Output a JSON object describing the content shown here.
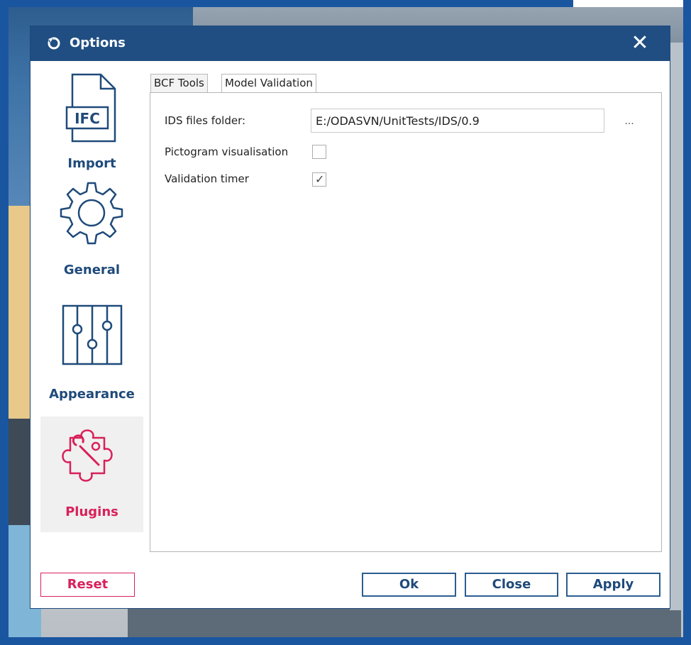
{
  "dialog": {
    "title": "Options",
    "title_icon": "refresh-circle-icon",
    "close_icon": "close-x-icon",
    "close_glyph": "✕"
  },
  "sidebar": {
    "items": [
      {
        "label": "Import",
        "icon": "ifc-file-icon",
        "icon_text": "IFC",
        "active": false
      },
      {
        "label": "General",
        "icon": "gear-icon",
        "active": false
      },
      {
        "label": "Appearance",
        "icon": "sliders-icon",
        "active": false
      },
      {
        "label": "Plugins",
        "icon": "puzzle-wrench-icon",
        "active": true
      }
    ]
  },
  "tabs": [
    {
      "label": "BCF Tools",
      "active": false
    },
    {
      "label": "Model Validation",
      "active": true
    }
  ],
  "model_validation": {
    "ids_folder_label": "IDS files folder:",
    "ids_folder_value": "E:/ODASVN/UnitTests/IDS/0.9",
    "browse_label": "...",
    "pictogram_label": "Pictogram visualisation",
    "pictogram_checked": false,
    "timer_label": "Validation timer",
    "timer_checked": true,
    "check_glyph": "✓"
  },
  "buttons": {
    "reset": "Reset",
    "ok": "Ok",
    "close": "Close",
    "apply": "Apply"
  },
  "colors": {
    "titlebar": "#204e82",
    "accent_blue": "#1f4a7a",
    "accent_pink": "#d8215a"
  }
}
